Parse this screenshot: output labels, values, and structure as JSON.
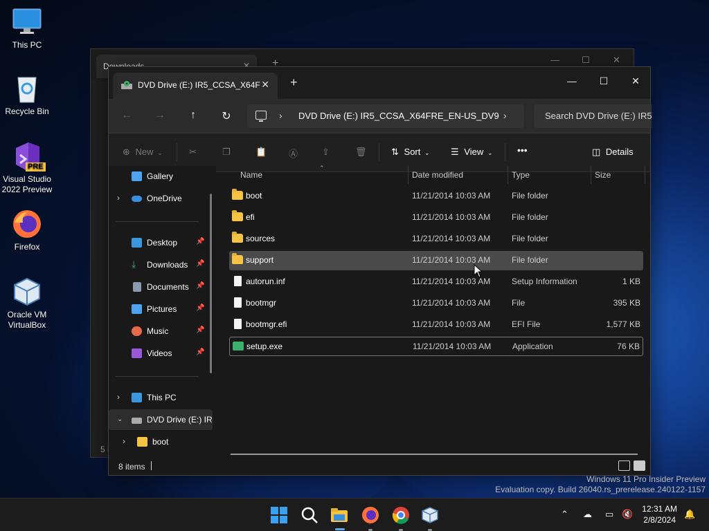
{
  "desktop": {
    "icons": [
      {
        "label": "This PC"
      },
      {
        "label": "Recycle Bin"
      },
      {
        "label": "Visual Studio 2022 Preview"
      },
      {
        "label": "Firefox"
      },
      {
        "label": "Oracle VM VirtualBox"
      }
    ],
    "vs_badge": "PRE",
    "watermark": {
      "line1": "Windows 11 Pro Insider Preview",
      "line2": "Evaluation copy. Build 26040.rs_prerelease.240122-1157"
    }
  },
  "back_window": {
    "tab_title": "Downloads",
    "status_fragment": "5 i"
  },
  "explorer": {
    "tab_title": "DVD Drive (E:) IR5_CCSA_X64F",
    "address": {
      "crumb": "DVD Drive (E:) IR5_CCSA_X64FRE_EN-US_DV9"
    },
    "search_placeholder": "Search DVD Drive (E:) IR5",
    "toolbar": {
      "new_label": "New",
      "sort_label": "Sort",
      "view_label": "View",
      "more_label": "•••",
      "details_label": "Details"
    },
    "sidebar": {
      "gallery": "Gallery",
      "onedrive": "OneDrive",
      "quick": [
        {
          "label": "Desktop"
        },
        {
          "label": "Downloads"
        },
        {
          "label": "Documents"
        },
        {
          "label": "Pictures"
        },
        {
          "label": "Music"
        },
        {
          "label": "Videos"
        }
      ],
      "this_pc": "This PC",
      "dvd": "DVD Drive (E:) IR",
      "boot": "boot"
    },
    "columns": {
      "name": "Name",
      "date": "Date modified",
      "type": "Type",
      "size": "Size"
    },
    "files": [
      {
        "name": "boot",
        "date": "11/21/2014 10:03 AM",
        "type": "File folder",
        "size": "",
        "icon": "folder"
      },
      {
        "name": "efi",
        "date": "11/21/2014 10:03 AM",
        "type": "File folder",
        "size": "",
        "icon": "folder"
      },
      {
        "name": "sources",
        "date": "11/21/2014 10:03 AM",
        "type": "File folder",
        "size": "",
        "icon": "folder"
      },
      {
        "name": "support",
        "date": "11/21/2014 10:03 AM",
        "type": "File folder",
        "size": "",
        "icon": "folder"
      },
      {
        "name": "autorun.inf",
        "date": "11/21/2014 10:03 AM",
        "type": "Setup Information",
        "size": "1 KB",
        "icon": "settings-file"
      },
      {
        "name": "bootmgr",
        "date": "11/21/2014 10:03 AM",
        "type": "File",
        "size": "395 KB",
        "icon": "file"
      },
      {
        "name": "bootmgr.efi",
        "date": "11/21/2014 10:03 AM",
        "type": "EFI File",
        "size": "1,577 KB",
        "icon": "file"
      },
      {
        "name": "setup.exe",
        "date": "11/21/2014 10:03 AM",
        "type": "Application",
        "size": "76 KB",
        "icon": "setup"
      }
    ],
    "status": "8 items"
  },
  "taskbar": {
    "time": "12:31 AM",
    "date": "2/8/2024"
  },
  "colors": {
    "folder": "#f5c243",
    "accent": "#60a8f0"
  }
}
